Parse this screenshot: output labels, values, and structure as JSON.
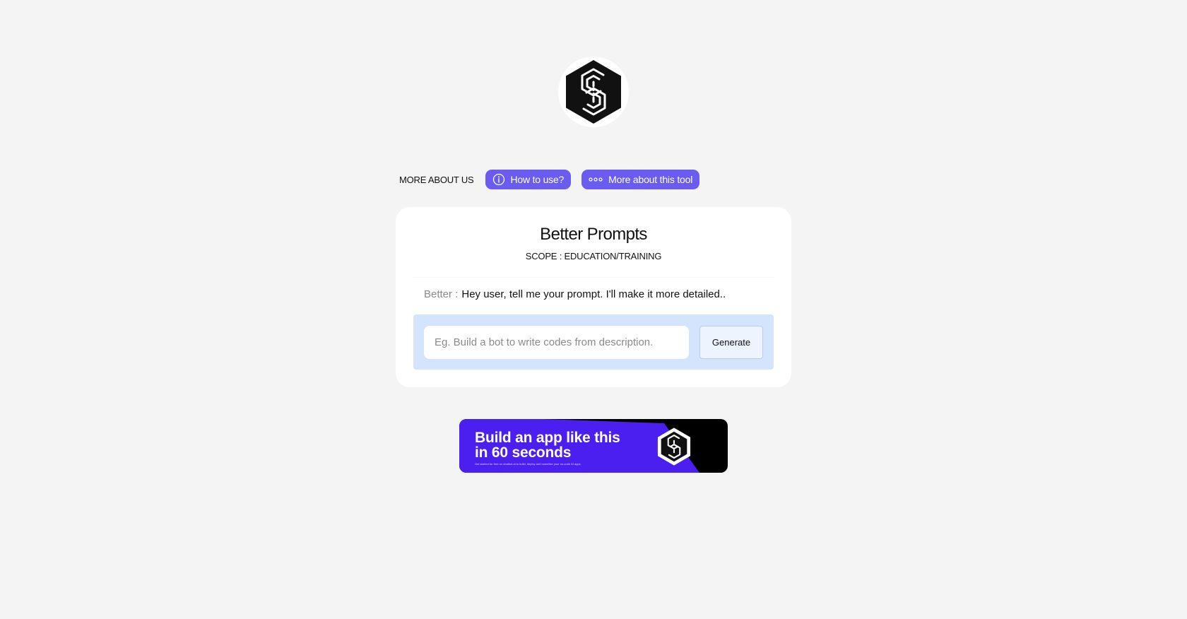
{
  "brand": {
    "logo_icon": "hexagon-s-logo-icon"
  },
  "about": {
    "label": "MORE ABOUT US",
    "how_to_use": "How to use?",
    "how_to_use_icon": "info-circle-icon",
    "more_about": "More about this tool",
    "more_about_icon": "dots-icon",
    "pill_color": "#6a5cf0"
  },
  "card": {
    "title": "Better Prompts",
    "scope": "SCOPE : EDUCATION/TRAINING",
    "message_prefix": "Better :",
    "message_text": "Hey user, tell me your prompt. I'll make it more detailed..",
    "input_placeholder": "Eg. Build a bot to write codes from description.",
    "input_value": "",
    "generate_label": "Generate",
    "panel_color": "#d3e4fc"
  },
  "banner": {
    "title": "Build an app like this in 60 seconds",
    "subtitle": "Get started for free on chatbot.ai to build, deploy and monetise your no-code AI apps",
    "accent_color": "#4a1ff0",
    "logo_icon": "hexagon-s-logo-icon"
  }
}
